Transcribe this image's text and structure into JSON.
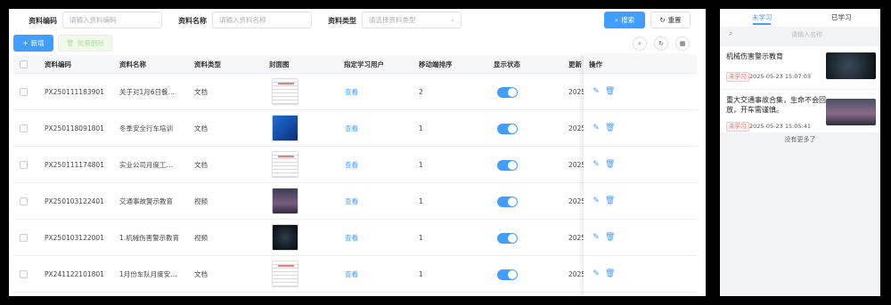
{
  "filters": {
    "code_label": "资料编码",
    "code_placeholder": "请输入资料编码",
    "name_label": "资料名称",
    "name_placeholder": "请输入资料名称",
    "type_label": "资料类型",
    "type_placeholder": "请选择资料类型",
    "search_label": "搜索",
    "reset_label": "重置"
  },
  "toolbar": {
    "add_label": "新增",
    "batch_delete_label": "批量删除"
  },
  "table": {
    "columns": [
      "资料编码",
      "资料名称",
      "资料类型",
      "封面图",
      "指定学习用户",
      "移动端排序",
      "显示状态",
      "更新",
      "操作"
    ],
    "rows": [
      {
        "code": "PX250111183901",
        "name": "关于对1月6日餐…",
        "type": "文档",
        "cover": "doc",
        "view": "查看",
        "sort": "2",
        "update": "2025"
      },
      {
        "code": "PX250118091801",
        "name": "冬季安全行车培训",
        "type": "文档",
        "cover": "blue",
        "view": "查看",
        "sort": "1",
        "update": "2025"
      },
      {
        "code": "PX250111174801",
        "name": "实业公司月度工…",
        "type": "文档",
        "cover": "doc",
        "view": "查看",
        "sort": "1",
        "update": "2025"
      },
      {
        "code": "PX250103122401",
        "name": "交通事故警示教育",
        "type": "视频",
        "cover": "video",
        "view": "查看",
        "sort": "1",
        "update": "2025"
      },
      {
        "code": "PX250103122001",
        "name": "1.机械伤害警示教育",
        "type": "视频",
        "cover": "dark",
        "view": "查看",
        "sort": "1",
        "update": "2025"
      },
      {
        "code": "PX241122101801",
        "name": "1月份车队月度安…",
        "type": "文档",
        "cover": "doc",
        "view": "查看",
        "sort": "1",
        "update": "2025"
      }
    ]
  },
  "side": {
    "tab_unlearned": "未学习",
    "tab_learned": "已学习",
    "search_placeholder": "请输入名称",
    "cards": [
      {
        "title": "机械伤害警示教育",
        "badge": "未学习",
        "time": "2025-05-23 15:07:03"
      },
      {
        "title": "重大交通事故合集，生命不会回放，开车需谨慎。",
        "badge": "未学习",
        "time": "2025-05-23 15:05:41"
      }
    ],
    "no_more": "没有更多了"
  },
  "colors": {
    "primary": "#409eff",
    "danger": "#f56c6c"
  }
}
